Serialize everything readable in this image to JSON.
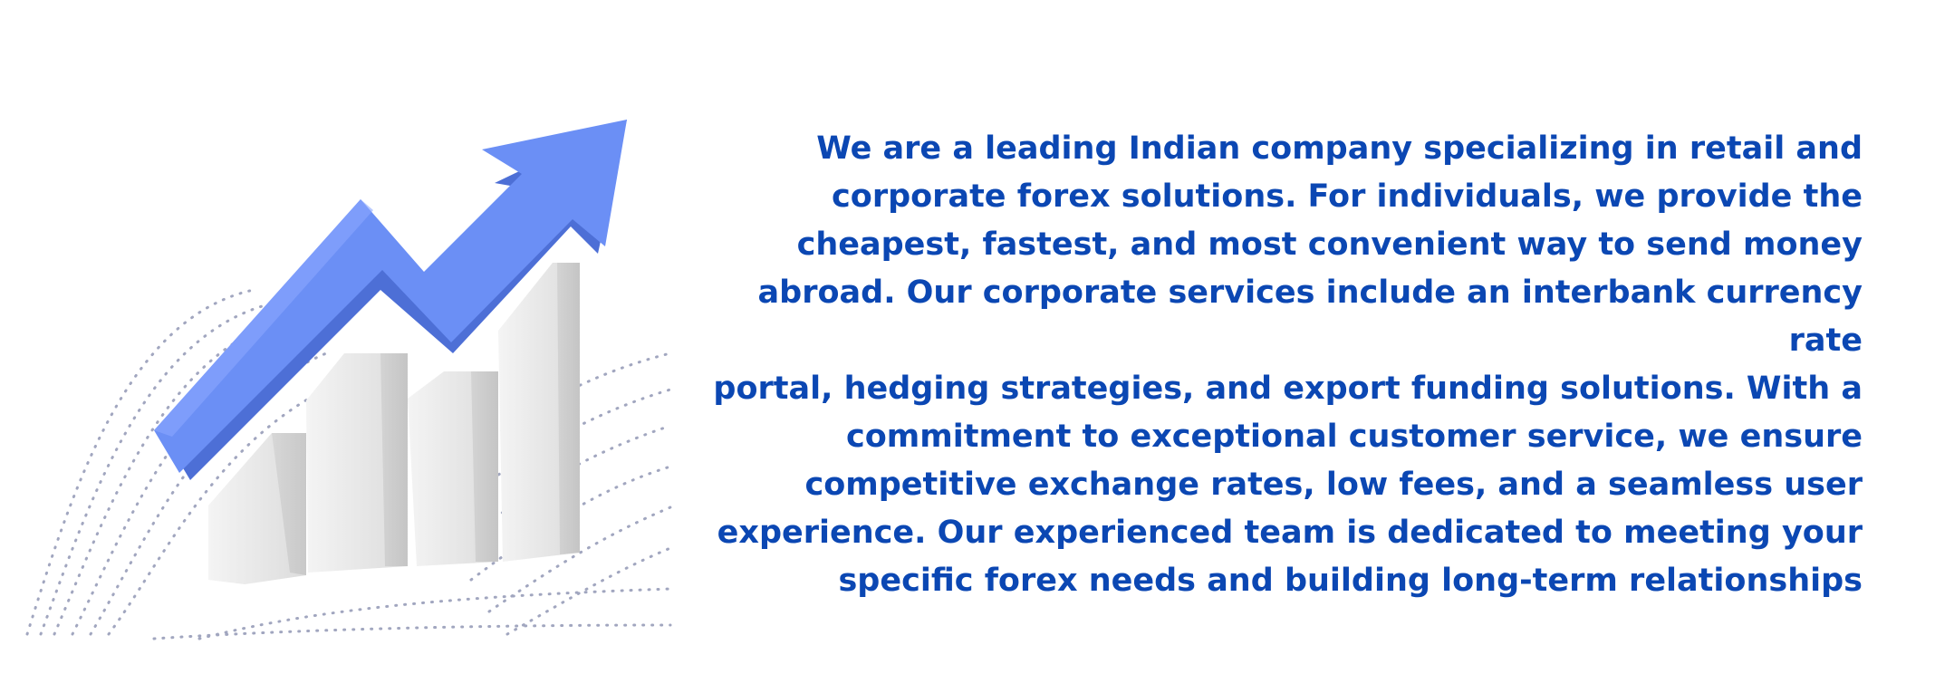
{
  "content": {
    "about_lines": [
      "We are a leading Indian company specializing in retail and",
      "corporate forex solutions. For individuals, we provide the",
      "cheapest, fastest, and most convenient way to send money",
      "abroad. Our corporate services include an interbank currency rate",
      "portal, hedging strategies, and export funding solutions. With a",
      "commitment to exceptional customer service, we ensure",
      "competitive exchange rates, low fees, and a seamless user",
      "experience. Our experienced team is dedicated to meeting your",
      "specific forex needs and building long-term relationships"
    ]
  },
  "illustration": {
    "icon": "growth-chart-arrow-icon",
    "arrow_color": "#6b8ff5",
    "bar_color": "#e6e6e6",
    "dot_color": "#8a90b0"
  },
  "colors": {
    "text": "#0b47b3",
    "background": "#ffffff"
  }
}
